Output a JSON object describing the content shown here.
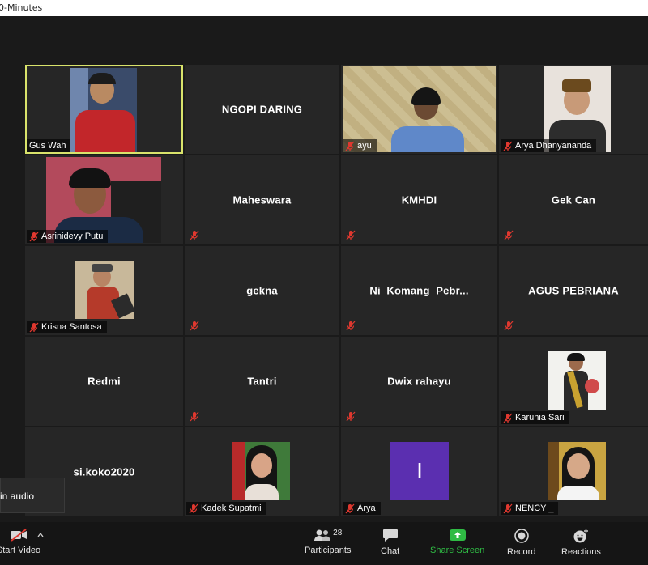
{
  "window": {
    "title": "0-Minutes"
  },
  "gallery": {
    "tiles": [
      {
        "name": "Gus Wah",
        "kind": "video",
        "active": true
      },
      {
        "name": "NGOPI DARING",
        "kind": "name"
      },
      {
        "name": "ayu",
        "kind": "video"
      },
      {
        "name": "Arya Dhanyananda",
        "kind": "video"
      },
      {
        "name": "Asrinidevy Putu",
        "kind": "video"
      },
      {
        "name": "Maheswara",
        "kind": "name"
      },
      {
        "name": "KMHDI",
        "kind": "name"
      },
      {
        "name": "Gek Can",
        "kind": "name"
      },
      {
        "name": "Krisna Santosa",
        "kind": "video"
      },
      {
        "name": "gekna",
        "kind": "name"
      },
      {
        "name": "Ni  Komang  Pebr...",
        "kind": "name"
      },
      {
        "name": "AGUS PEBRIANA",
        "kind": "name"
      },
      {
        "name": "Redmi",
        "kind": "name"
      },
      {
        "name": "Tantri",
        "kind": "name"
      },
      {
        "name": "Dwix rahayu",
        "kind": "name"
      },
      {
        "name": "Karunia Sari",
        "kind": "video"
      },
      {
        "name": "si.koko2020",
        "kind": "name"
      },
      {
        "name": "Kadek Supatmi",
        "kind": "video"
      },
      {
        "name": "Arya",
        "kind": "avatar",
        "initial": "I",
        "avatar_color": "#5b2fb0"
      },
      {
        "name": "NENCY _",
        "kind": "video"
      }
    ]
  },
  "audio_popup": {
    "text": "in audio"
  },
  "toolbar": {
    "start_video": "Start Video",
    "participants": "Participants",
    "participants_count": "28",
    "chat": "Chat",
    "share_screen": "Share Screen",
    "record": "Record",
    "reactions": "Reactions"
  },
  "colors": {
    "background": "#1a1a1a",
    "tile": "#262626",
    "active_border": "#d9e36b",
    "muted_red": "#e0382f",
    "share_green": "#2fbb44",
    "avatar_purple": "#5b2fb0"
  }
}
